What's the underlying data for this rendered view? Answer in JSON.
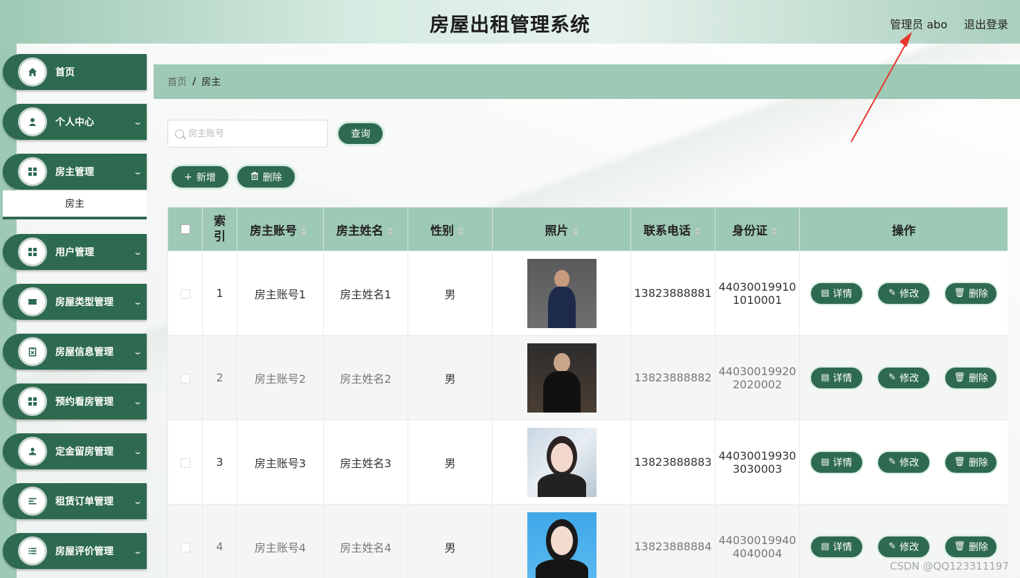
{
  "header": {
    "title": "房屋出租管理系统",
    "admin_label": "管理员 abo",
    "logout_label": "退出登录"
  },
  "sidebar": {
    "items": [
      {
        "label": "首页",
        "icon": "home-icon",
        "has_chevron": false
      },
      {
        "label": "个人中心",
        "icon": "user-icon",
        "has_chevron": true
      },
      {
        "label": "房主管理",
        "icon": "grid-icon",
        "has_chevron": true
      },
      {
        "label": "用户管理",
        "icon": "grid-icon",
        "has_chevron": true
      },
      {
        "label": "房屋类型管理",
        "icon": "ticket-icon",
        "has_chevron": true
      },
      {
        "label": "房屋信息管理",
        "icon": "clipboard-icon",
        "has_chevron": true
      },
      {
        "label": "预约看房管理",
        "icon": "grid-icon",
        "has_chevron": true
      },
      {
        "label": "定金留房管理",
        "icon": "user-icon",
        "has_chevron": true
      },
      {
        "label": "租赁订单管理",
        "icon": "list-icon",
        "has_chevron": true
      },
      {
        "label": "房屋评价管理",
        "icon": "list-icon",
        "has_chevron": true
      }
    ],
    "submenu_label": "房主"
  },
  "breadcrumb": {
    "home": "首页",
    "separator": "/",
    "current": "房主"
  },
  "search": {
    "placeholder": "房主账号",
    "value": "",
    "query_label": "查询"
  },
  "toolbar": {
    "add_label": "新增",
    "delete_label": "删除"
  },
  "table": {
    "headers": {
      "index": "索引",
      "account": "房主账号",
      "name": "房主姓名",
      "gender": "性别",
      "photo": "照片",
      "phone": "联系电话",
      "id_card": "身份证",
      "actions": "操作"
    },
    "rows": [
      {
        "index": "1",
        "account": "房主账号1",
        "name": "房主姓名1",
        "gender": "男",
        "phone": "13823888881",
        "id_line1": "44030019910",
        "id_line2": "1010001"
      },
      {
        "index": "2",
        "account": "房主账号2",
        "name": "房主姓名2",
        "gender": "男",
        "phone": "13823888882",
        "id_line1": "44030019920",
        "id_line2": "2020002"
      },
      {
        "index": "3",
        "account": "房主账号3",
        "name": "房主姓名3",
        "gender": "男",
        "phone": "13823888883",
        "id_line1": "44030019930",
        "id_line2": "3030003"
      },
      {
        "index": "4",
        "account": "房主账号4",
        "name": "房主姓名4",
        "gender": "男",
        "phone": "13823888884",
        "id_line1": "44030019940",
        "id_line2": "4040004"
      }
    ],
    "action_labels": {
      "detail": "详情",
      "edit": "修改",
      "delete": "删除"
    }
  },
  "watermark": "CSDN @QQ123311197",
  "colors": {
    "primary": "#2e6a4f",
    "light": "#9ec9b5",
    "annotation": "#e8362b"
  }
}
